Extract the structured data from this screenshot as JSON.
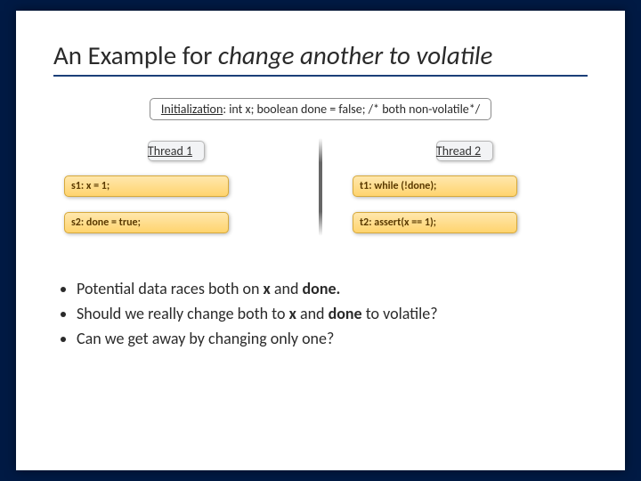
{
  "title": {
    "prefix": "An Example for ",
    "italic": "change another to volatile"
  },
  "init": {
    "label": "Initialization",
    "code": ": int x; boolean done = false; /* both non-volatile*/"
  },
  "threads": {
    "left": {
      "header": "Thread 1",
      "rows": [
        "s1: x = 1;",
        "s2: done = true;"
      ]
    },
    "right": {
      "header": "Thread 2",
      "rows": [
        "t1: while (!done);",
        "t2: assert(x == 1);"
      ]
    }
  },
  "bullets": [
    {
      "pre": "Potential data races both on ",
      "b1": "x",
      "mid": " and ",
      "b2": "done.",
      "post": ""
    },
    {
      "pre": "Should we really change both to ",
      "b1": "x",
      "mid": " and ",
      "b2": "done",
      "post": " to volatile?"
    },
    {
      "pre": "Can we get away by changing only one?",
      "b1": "",
      "mid": "",
      "b2": "",
      "post": ""
    }
  ]
}
